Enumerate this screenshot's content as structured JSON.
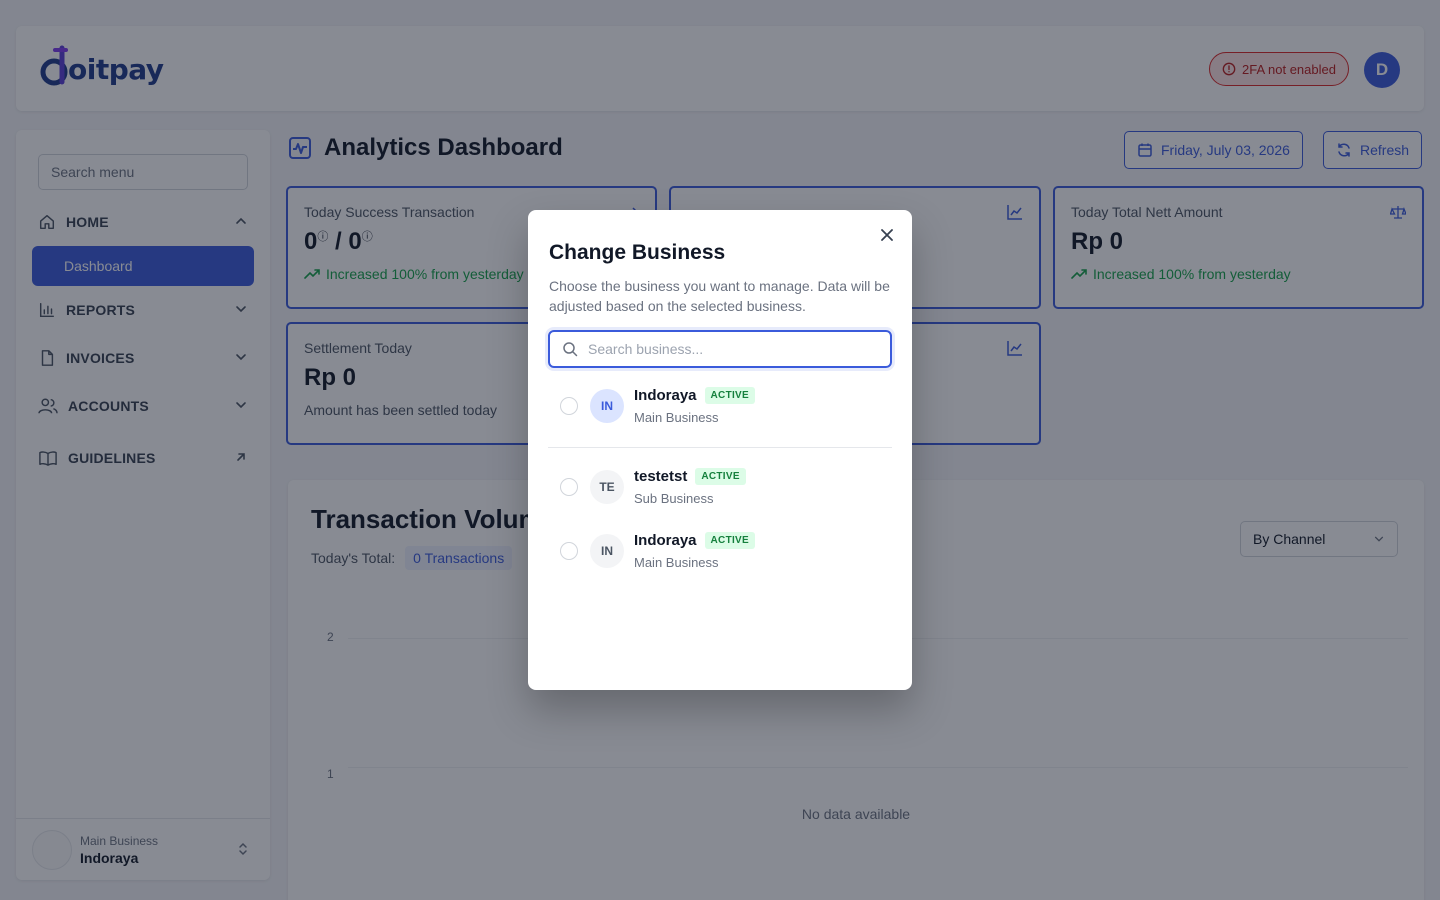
{
  "header": {
    "logo_text": "oitpay",
    "twofa_badge": "2FA not enabled",
    "avatar_initial": "D"
  },
  "sidebar": {
    "search_placeholder": "Search menu",
    "items": [
      {
        "label": "HOME",
        "icon": "home-icon",
        "expanded": true
      },
      {
        "label": "REPORTS",
        "icon": "bar-chart-icon",
        "expanded": false
      },
      {
        "label": "INVOICES",
        "icon": "file-icon",
        "expanded": false
      },
      {
        "label": "ACCOUNTS",
        "icon": "users-icon",
        "expanded": false
      },
      {
        "label": "GUIDELINES",
        "icon": "book-icon",
        "external": true
      }
    ],
    "active_sub": "Dashboard",
    "footer": {
      "role": "Main Business",
      "name": "Indoraya"
    }
  },
  "main": {
    "title": "Analytics Dashboard",
    "date_button": "Friday, July 03, 2026",
    "refresh_button": "Refresh",
    "cards": [
      {
        "label": "Today Success Transaction",
        "value_left": "0",
        "value_right": "0",
        "trend": "Increased 100% from yesterday"
      },
      {
        "label": "Today Total Nett Amount",
        "value": "Rp 0",
        "trend": "Increased 100% from yesterday"
      },
      {
        "label": "Settlement Today",
        "value": "Rp 0",
        "note": "Amount has been settled today"
      }
    ],
    "volume": {
      "title": "Transaction Volume",
      "total_label": "Today's Total:",
      "total_value": "0 Transactions",
      "group_select": "By Channel",
      "y_ticks": [
        "2",
        "1"
      ],
      "empty_text": "No data available"
    }
  },
  "modal": {
    "title": "Change Business",
    "description": "Choose the business you want to manage. Data will be adjusted based on the selected business.",
    "search_placeholder": "Search business...",
    "businesses": [
      {
        "initials": "IN",
        "name": "Indoraya",
        "status": "ACTIVE",
        "type": "Main Business",
        "current": true
      },
      {
        "initials": "TE",
        "name": "testetst",
        "status": "ACTIVE",
        "type": "Sub Business",
        "current": false
      },
      {
        "initials": "IN",
        "name": "Indoraya",
        "status": "ACTIVE",
        "type": "Main Business",
        "current": false
      }
    ]
  },
  "colors": {
    "accent": "#3b5bdb",
    "success": "#16a34a",
    "danger": "#dc2626",
    "brand_dark": "#1e3a8a"
  }
}
